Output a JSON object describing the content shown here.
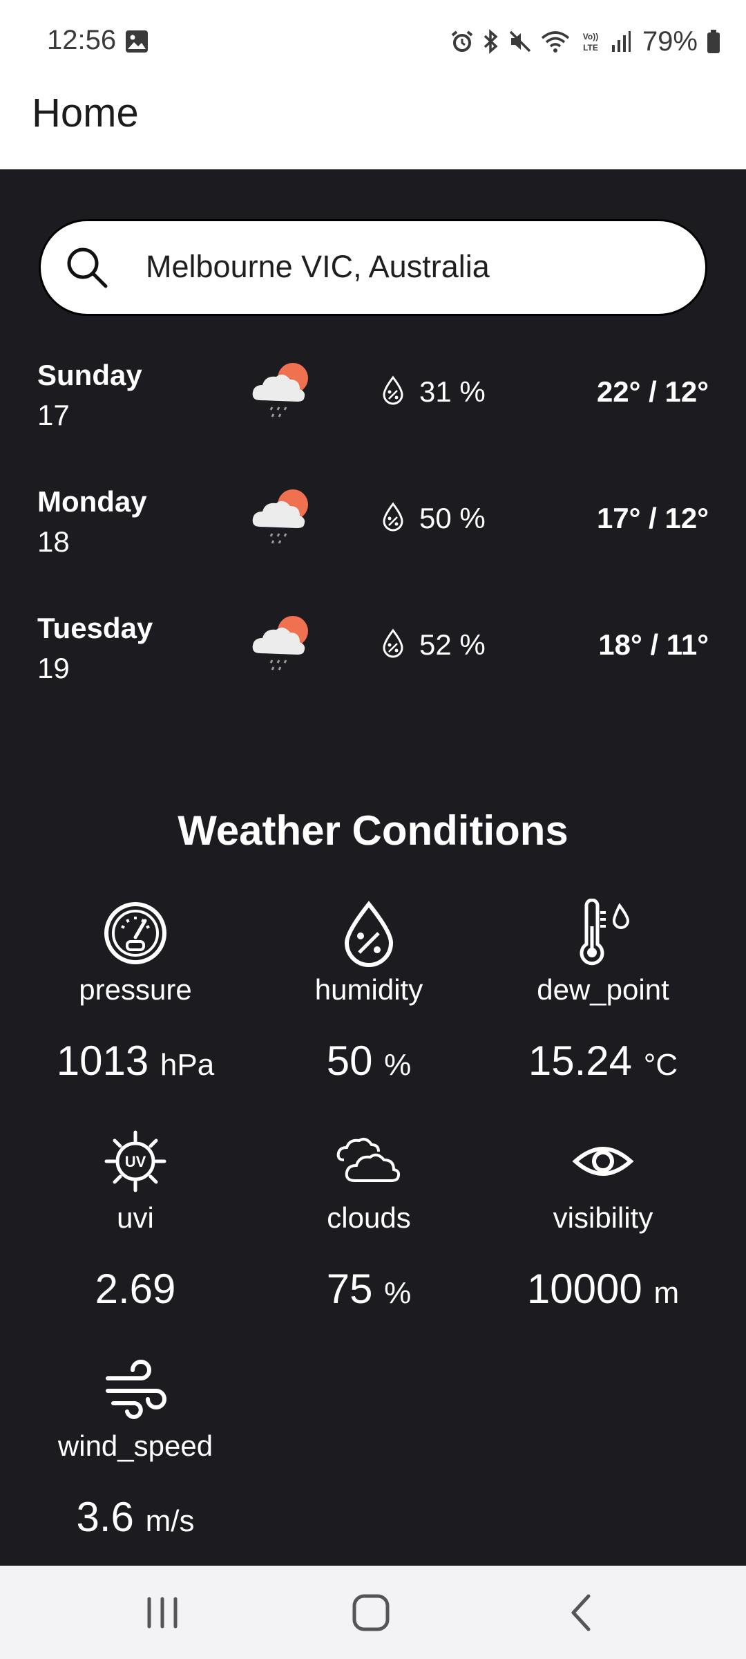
{
  "status_bar": {
    "time": "12:56",
    "battery": "79%",
    "icons": [
      "gallery-icon",
      "alarm-icon",
      "bluetooth-icon",
      "mute-icon",
      "wifi-icon",
      "volte-icon",
      "signal-icon",
      "battery-icon"
    ]
  },
  "app_bar": {
    "title": "Home"
  },
  "search": {
    "value": "Melbourne VIC, Australia",
    "icon": "search-icon"
  },
  "forecast": [
    {
      "day": "Sunday",
      "date": "17",
      "icon": "cloud-rain-sun-icon",
      "humidity": "31 %",
      "temps": "22° / 12°"
    },
    {
      "day": "Monday",
      "date": "18",
      "icon": "cloud-rain-sun-icon",
      "humidity": "50 %",
      "temps": "17° / 12°"
    },
    {
      "day": "Tuesday",
      "date": "19",
      "icon": "cloud-rain-sun-icon",
      "humidity": "52 %",
      "temps": "18° / 11°"
    }
  ],
  "conditions": {
    "title": "Weather Conditions",
    "items": [
      {
        "label": "pressure",
        "value": "1013",
        "unit": "hPa",
        "icon": "gauge-icon"
      },
      {
        "label": "humidity",
        "value": "50",
        "unit": "%",
        "icon": "humidity-drop-icon"
      },
      {
        "label": "dew_point",
        "value": "15.24",
        "unit": "°C",
        "icon": "thermometer-drop-icon"
      },
      {
        "label": "uvi",
        "value": "2.69",
        "unit": "",
        "icon": "uv-sun-icon"
      },
      {
        "label": "clouds",
        "value": "75",
        "unit": "%",
        "icon": "clouds-icon"
      },
      {
        "label": "visibility",
        "value": "10000",
        "unit": "m",
        "icon": "eye-icon"
      },
      {
        "label": "wind_speed",
        "value": "3.6",
        "unit": "m/s",
        "icon": "wind-icon"
      }
    ]
  },
  "nav": {
    "icons": [
      "recent-apps-icon",
      "home-icon",
      "back-icon"
    ]
  },
  "colors": {
    "background": "#1c1b1f",
    "sun": "#f0714f",
    "cloud": "#ececec",
    "nav_bar": "#f3f3f5"
  }
}
